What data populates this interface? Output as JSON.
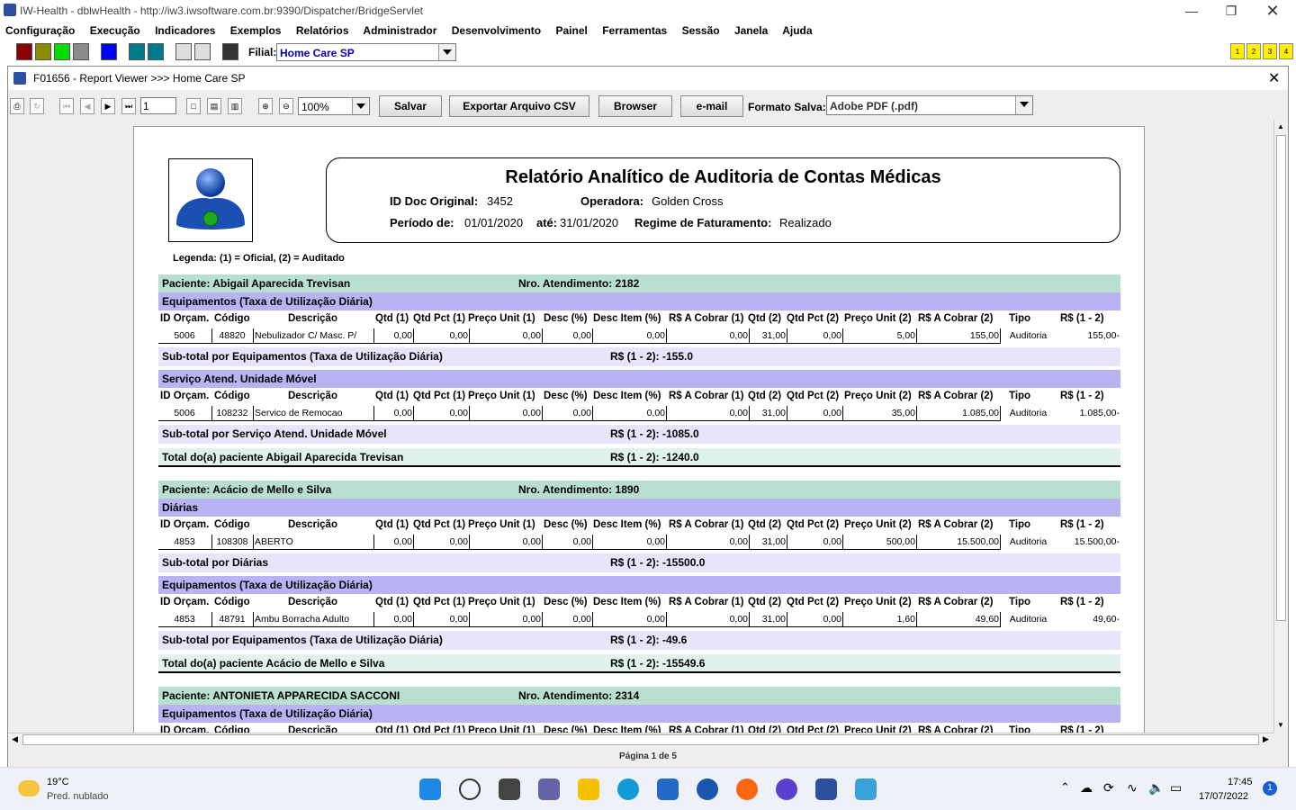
{
  "window": {
    "title": "IW-Health - dblwHealth - http://iw3.iwsoftware.com.br:9390/Dispatcher/BridgeServlet"
  },
  "menu": [
    "Configuração",
    "Execução",
    "Indicadores",
    "Exemplos",
    "Relatórios",
    "Administrador",
    "Desenvolvimento",
    "Painel",
    "Ferramentas",
    "Sessão",
    "Janela",
    "Ajuda"
  ],
  "toolbar": {
    "filial_label": "Filial:",
    "filial_value": "Home Care SP",
    "colors": [
      "#8b0000",
      "#8b8b00",
      "#00e000",
      "#8b8b8b",
      "#0000ff",
      "#007b8b",
      "#007b8b"
    ],
    "quick": [
      "1",
      "2",
      "3",
      "4"
    ]
  },
  "viewer": {
    "title": "F01656 - Report Viewer >>> Home Care SP",
    "page_input": "1",
    "zoom": "100%",
    "buttons": {
      "save": "Salvar",
      "export": "Exportar Arquivo CSV",
      "browser": "Browser",
      "email": "e-mail"
    },
    "format_label": "Formato Salva:",
    "format_value": "Adobe PDF (.pdf)",
    "status": "Página 1 de 5"
  },
  "report": {
    "title": "Relatório Analítico de Auditoria de Contas Médicas",
    "id_label": "ID Doc Original:",
    "id_value": "3452",
    "operadora_label": "Operadora:",
    "operadora_value": "Golden Cross",
    "periodo_label": "Período de:",
    "periodo_de": "01/01/2020",
    "ate_label": "até:",
    "periodo_ate": "31/01/2020",
    "regime_label": "Regime de Faturamento:",
    "regime_value": "Realizado",
    "legend": "Legenda: (1) = Oficial, (2) = Auditado",
    "columns": [
      "ID Orçam.",
      "Código",
      "Descrição",
      "Qtd (1)",
      "Qtd Pct (1)",
      "Preço Unit (1)",
      "Desc (%)",
      "Desc Item (%)",
      "R$ A Cobrar (1)",
      "Qtd (2)",
      "Qtd Pct (2)",
      "Preço Unit (2)",
      "R$ A Cobrar (2)",
      "Tipo",
      "R$ (1 - 2)"
    ],
    "patients": [
      {
        "paciente": "Paciente: Abigail Aparecida Trevisan",
        "atendimento": "Nro. Atendimento: 2182",
        "groups": [
          {
            "category": "Equipamentos (Taxa de Utilização Diária)",
            "row": [
              "5006",
              "48820",
              "Nebulizador C/ Masc. P/",
              "0,00",
              "0,00",
              "0,00",
              "0,00",
              "0,00",
              "0,00",
              "31,00",
              "0,00",
              "5,00",
              "155,00",
              "Auditoria",
              "155,00-"
            ],
            "subtotal": "Sub-total por Equipamentos (Taxa de Utilização Diária)",
            "subtotal_value": "R$ (1 - 2): -155.0"
          },
          {
            "category": "Serviço Atend. Unidade Móvel",
            "row": [
              "5006",
              "108232",
              "Servico de Remocao",
              "0,00",
              "0,00",
              "0,00",
              "0,00",
              "0,00",
              "0,00",
              "31,00",
              "0,00",
              "35,00",
              "1.085,00",
              "Auditoria",
              "1.085,00-"
            ],
            "subtotal": "Sub-total por Serviço Atend. Unidade Móvel",
            "subtotal_value": "R$ (1 - 2): -1085.0"
          }
        ],
        "total": "Total do(a) paciente Abigail Aparecida Trevisan",
        "total_value": "R$ (1 - 2): -1240.0"
      },
      {
        "paciente": "Paciente: Acácio de Mello e Silva",
        "atendimento": "Nro. Atendimento: 1890",
        "groups": [
          {
            "category": "Diárias",
            "row": [
              "4853",
              "108308",
              "ABERTO",
              "0,00",
              "0,00",
              "0,00",
              "0,00",
              "0,00",
              "0,00",
              "31,00",
              "0,00",
              "500,00",
              "15.500,00",
              "Auditoria",
              "15.500,00-"
            ],
            "subtotal": "Sub-total por Diárias",
            "subtotal_value": "R$ (1 - 2): -15500.0"
          },
          {
            "category": "Equipamentos (Taxa de Utilização Diária)",
            "row": [
              "4853",
              "48791",
              "Ambu Borracha Adulto",
              "0,00",
              "0,00",
              "0,00",
              "0,00",
              "0,00",
              "0,00",
              "31,00",
              "0,00",
              "1,60",
              "49,60",
              "Auditoria",
              "49,60-"
            ],
            "subtotal": "Sub-total por Equipamentos (Taxa de Utilização Diária)",
            "subtotal_value": "R$ (1 - 2): -49.6"
          }
        ],
        "total": "Total do(a) paciente Acácio de Mello e Silva",
        "total_value": "R$ (1 - 2): -15549.6"
      }
    ],
    "third_patient": {
      "paciente": "Paciente: ANTONIETA APPARECIDA SACCONI",
      "atendimento": "Nro. Atendimento: 2314",
      "category": "Equipamentos (Taxa de Utilização Diária)"
    }
  },
  "taskbar": {
    "weather_temp": "19°C",
    "weather_desc": "Pred. nublado",
    "time": "17:45",
    "date": "17/07/2022",
    "badge": "1"
  }
}
